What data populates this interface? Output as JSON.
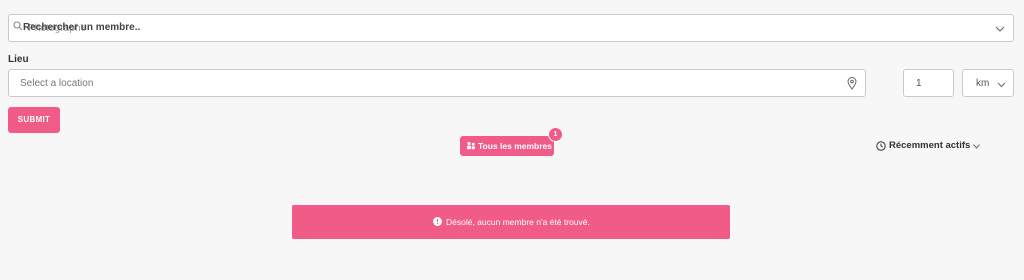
{
  "search": {
    "placeholder": "Rechercher un membre..",
    "ghost_text": "Photographe"
  },
  "location": {
    "label": "Lieu",
    "placeholder": "Select a location",
    "radius_value": "1",
    "unit_value": "km"
  },
  "submit_label": "SUBMIT",
  "filters": {
    "all_members_label": "Tous les membres",
    "count": "1",
    "sort_label": "Récemment actifs"
  },
  "empty_state": {
    "message": "Désolé, aucun membre n'a été trouvé."
  },
  "colors": {
    "accent": "#f05b88",
    "background": "#f7f7f7"
  },
  "icons": [
    "search-icon",
    "chevron-down-icon",
    "location-pin-icon",
    "members-icon",
    "clock-icon",
    "info-icon"
  ]
}
